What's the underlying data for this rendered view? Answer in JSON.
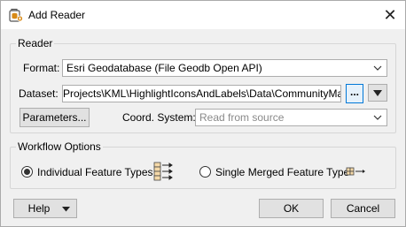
{
  "window": {
    "title": "Add Reader",
    "close_glyph": "✕"
  },
  "reader": {
    "group_label": "Reader",
    "format_label": "Format:",
    "format_value": "Esri Geodatabase (File Geodb Open API)",
    "dataset_label": "Dataset:",
    "dataset_value": "Projects\\KML\\HighlightIconsAndLabels\\Data\\CommunityMap.gdb\"",
    "browse_label": "...",
    "parameters_label": "Parameters...",
    "coord_label": "Coord. System:",
    "coord_placeholder": "Read from source"
  },
  "workflow": {
    "group_label": "Workflow Options",
    "options": [
      {
        "label": "Individual Feature Types",
        "selected": true
      },
      {
        "label": "Single Merged Feature Type",
        "selected": false
      }
    ]
  },
  "buttons": {
    "help_label": "Help",
    "ok_label": "OK",
    "cancel_label": "Cancel"
  },
  "icons": {
    "title": "reader-icon",
    "close": "close-icon",
    "dropdown": "chevron-down-icon",
    "menu": "triangle-down-icon",
    "individual": "individual-feature-types-icon",
    "merged": "merged-feature-type-icon"
  },
  "colors": {
    "accent": "#0078d7",
    "icon_orange": "#d88a16",
    "window_bg": "#f0f0f0"
  }
}
